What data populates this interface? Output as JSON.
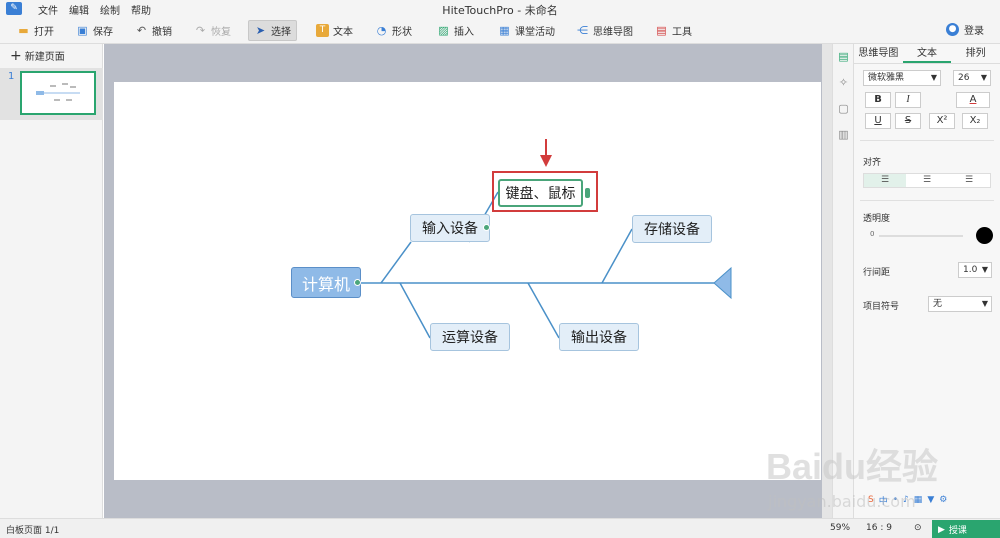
{
  "window": {
    "title": "HiteTouchPro - 未命名",
    "menus": [
      "文件",
      "编辑",
      "绘制",
      "帮助"
    ]
  },
  "toolbar": {
    "items": [
      {
        "label": "打开",
        "icon": "folder-open-icon"
      },
      {
        "label": "保存",
        "icon": "save-icon"
      },
      {
        "label": "撤销",
        "icon": "undo-icon"
      },
      {
        "label": "恢复",
        "icon": "redo-icon"
      },
      {
        "label": "选择",
        "icon": "cursor-icon"
      },
      {
        "label": "文本",
        "icon": "text-icon"
      },
      {
        "label": "形状",
        "icon": "shape-icon"
      },
      {
        "label": "插入",
        "icon": "insert-icon"
      },
      {
        "label": "课堂活动",
        "icon": "classroom-icon"
      },
      {
        "label": "思维导图",
        "icon": "mindmap-icon"
      },
      {
        "label": "工具",
        "icon": "toolbox-icon"
      }
    ],
    "active": "选择",
    "disabled": "恢复",
    "login": "登录"
  },
  "pages": {
    "new_page": "新建页面",
    "current": "1"
  },
  "mindmap": {
    "root": "计算机",
    "nodes": {
      "input": "输入设备",
      "keyboard": "键盘、鼠标",
      "storage": "存储设备",
      "compute": "运算设备",
      "output": "输出设备"
    }
  },
  "props": {
    "tabs": [
      "思维导图",
      "文本",
      "排列"
    ],
    "active_tab": "文本",
    "font_family": "微软雅黑",
    "font_size": "26",
    "bold": "B",
    "italic": "I",
    "font_color": "A",
    "underline": "U",
    "strike": "S",
    "superscript": "X²",
    "subscript": "X₂",
    "align_label": "对齐",
    "opacity_label": "透明度",
    "opacity_value": "0",
    "line_spacing_label": "行间距",
    "line_spacing": "1.0",
    "bullet_label": "项目符号",
    "bullet": "无"
  },
  "status": {
    "page_info": "白板页面 1/1",
    "zoom": "59%",
    "ratio": "16 : 9",
    "lesson": "授课"
  },
  "watermark": {
    "logo": "Baidu经验",
    "url": "jingyan.baidu.com"
  },
  "colors": {
    "accent": "#2aa56f",
    "root_fill": "#8fbae7",
    "node_fill": "#e3eef8",
    "line": "#4a90c8",
    "highlight": "#d23c3c"
  }
}
